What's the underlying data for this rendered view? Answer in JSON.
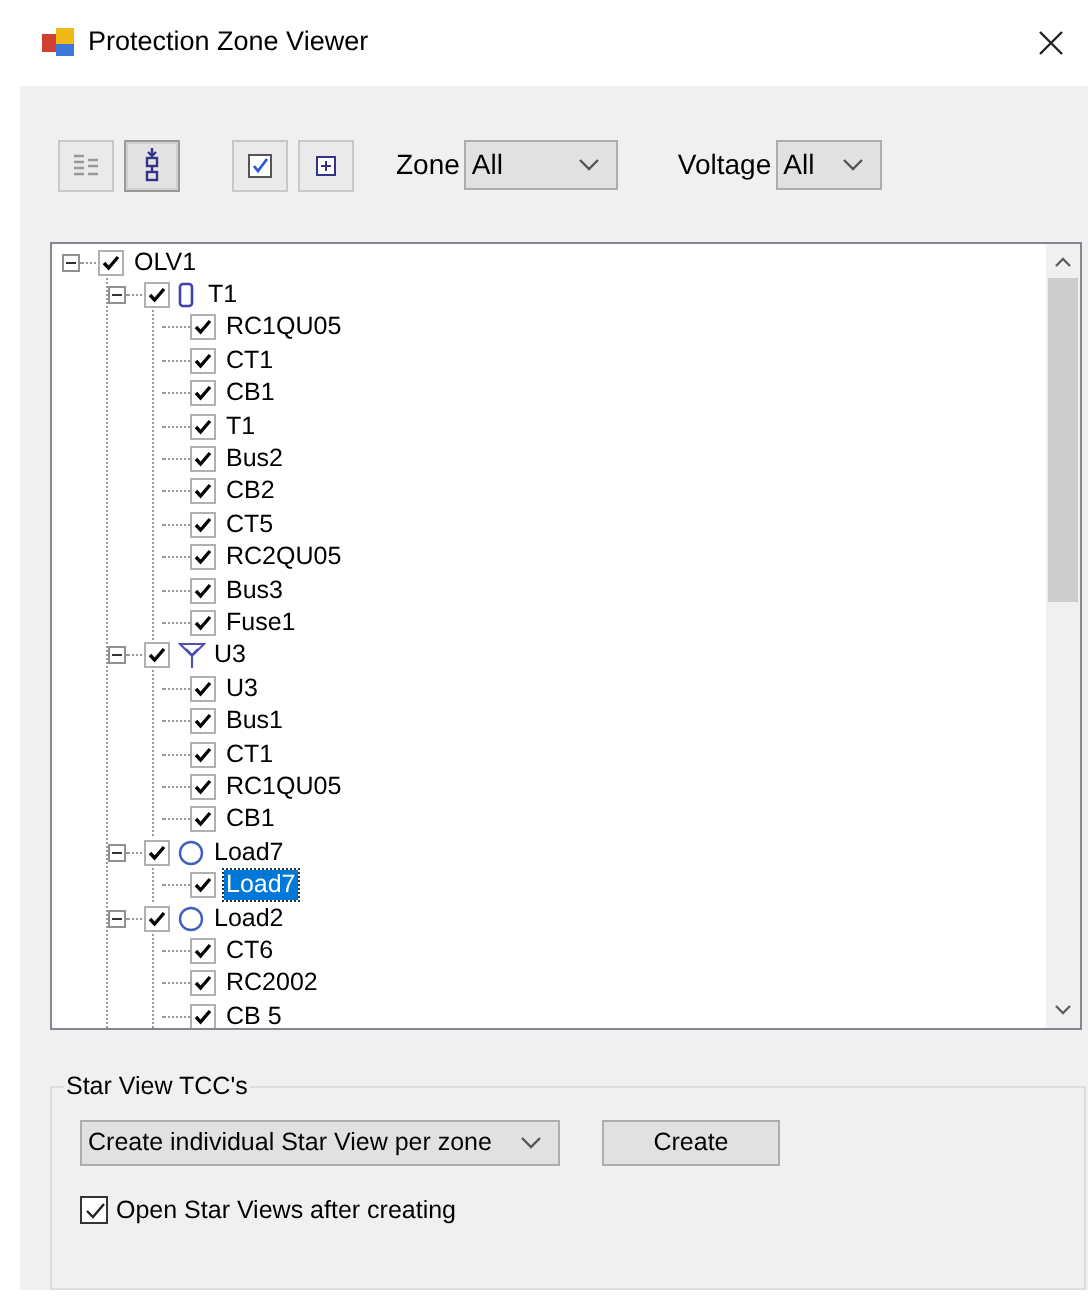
{
  "window": {
    "title": "Protection Zone Viewer"
  },
  "toolbar": [
    {
      "kind": "list",
      "pressed": false
    },
    {
      "kind": "tree",
      "pressed": true
    },
    {
      "kind": "check",
      "pressed": false
    },
    {
      "kind": "expand",
      "pressed": false
    }
  ],
  "filters": [
    {
      "label": "Zone",
      "value": "All"
    },
    {
      "label": "Voltage",
      "value": "All"
    }
  ],
  "tree": [
    {
      "label": "OLV1",
      "checked": true,
      "expanded": true,
      "selected": false,
      "children": [
        {
          "label": "T1",
          "kind": "transformer",
          "checked": true,
          "expanded": true,
          "selected": false,
          "children": [
            {
              "label": "RC1QU05",
              "checked": true,
              "selected": false
            },
            {
              "label": "CT1",
              "checked": true,
              "selected": false
            },
            {
              "label": "CB1",
              "checked": true,
              "selected": false
            },
            {
              "label": "T1",
              "checked": true,
              "selected": false
            },
            {
              "label": "Bus2",
              "checked": true,
              "selected": false
            },
            {
              "label": "CB2",
              "checked": true,
              "selected": false
            },
            {
              "label": "CT5",
              "checked": true,
              "selected": false
            },
            {
              "label": "RC2QU05",
              "checked": true,
              "selected": false
            },
            {
              "label": "Bus3",
              "checked": true,
              "selected": false
            },
            {
              "label": "Fuse1",
              "checked": true,
              "selected": false
            }
          ]
        },
        {
          "label": "U3",
          "kind": "antenna",
          "checked": true,
          "expanded": true,
          "selected": false,
          "children": [
            {
              "label": "U3",
              "checked": true,
              "selected": false
            },
            {
              "label": "Bus1",
              "checked": true,
              "selected": false
            },
            {
              "label": "CT1",
              "checked": true,
              "selected": false
            },
            {
              "label": "RC1QU05",
              "checked": true,
              "selected": false
            },
            {
              "label": "CB1",
              "checked": true,
              "selected": false
            }
          ]
        },
        {
          "label": "Load7",
          "kind": "load",
          "checked": true,
          "expanded": true,
          "selected": false,
          "children": [
            {
              "label": "Load7",
              "checked": true,
              "selected": true
            }
          ]
        },
        {
          "label": "Load2",
          "kind": "load",
          "checked": true,
          "expanded": true,
          "selected": false,
          "children": [
            {
              "label": "CT6",
              "checked": true,
              "selected": false
            },
            {
              "label": "RC2002",
              "checked": true,
              "selected": false
            },
            {
              "label": "CB 5",
              "checked": true,
              "selected": false
            }
          ]
        }
      ]
    }
  ],
  "star_view": {
    "title": "Star View TCC's",
    "mode": "Create individual Star View per zone",
    "create_button": "Create",
    "open_after": {
      "label": "Open Star Views after creating",
      "checked": true
    }
  }
}
